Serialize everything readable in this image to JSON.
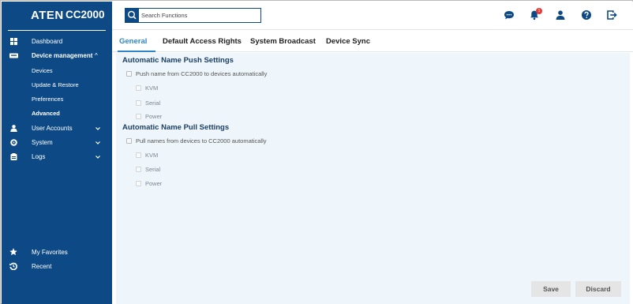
{
  "brand": {
    "logo": "ATEN",
    "model": "CC2000"
  },
  "sidebar": {
    "items": [
      {
        "label": "Dashboard",
        "icon": "grid-icon"
      },
      {
        "label": "Device management",
        "icon": "keyboard-icon",
        "chevron": "^"
      },
      {
        "label": "User Accounts",
        "icon": "user-icon",
        "chevron": "v"
      },
      {
        "label": "System",
        "icon": "gear-icon",
        "chevron": "v"
      },
      {
        "label": "Logs",
        "icon": "clipboard-icon",
        "chevron": "v"
      }
    ],
    "subitems": [
      "Devices",
      "Update & Restore",
      "Preferences",
      "Advanced"
    ],
    "bottom": [
      {
        "label": "My Favorites",
        "icon": "star-icon"
      },
      {
        "label": "Recent",
        "icon": "history-icon"
      }
    ]
  },
  "topbar": {
    "search_placeholder": "Search Functions",
    "notification_count": "1",
    "icons": [
      "chat-icon",
      "bell-icon",
      "user-icon",
      "help-icon",
      "logout-icon"
    ]
  },
  "tabs": [
    "General",
    "Default Access Rights",
    "System Broadcast",
    "Device Sync"
  ],
  "push": {
    "title": "Automatic Name Push Settings",
    "main": "Push name from CC2000 to devices automatically",
    "options": [
      "KVM",
      "Serial",
      "Power"
    ]
  },
  "pull": {
    "title": "Automatic Name Pull Settings",
    "main": "Pull names from devices to CC2000 automatically",
    "options": [
      "KVM",
      "Serial",
      "Power"
    ]
  },
  "buttons": {
    "save": "Save",
    "discard": "Discard"
  },
  "colors": {
    "sidebar": "#0d4a85",
    "accent": "#2e86c8",
    "panel": "#eef6fb",
    "badge": "#e53935"
  }
}
